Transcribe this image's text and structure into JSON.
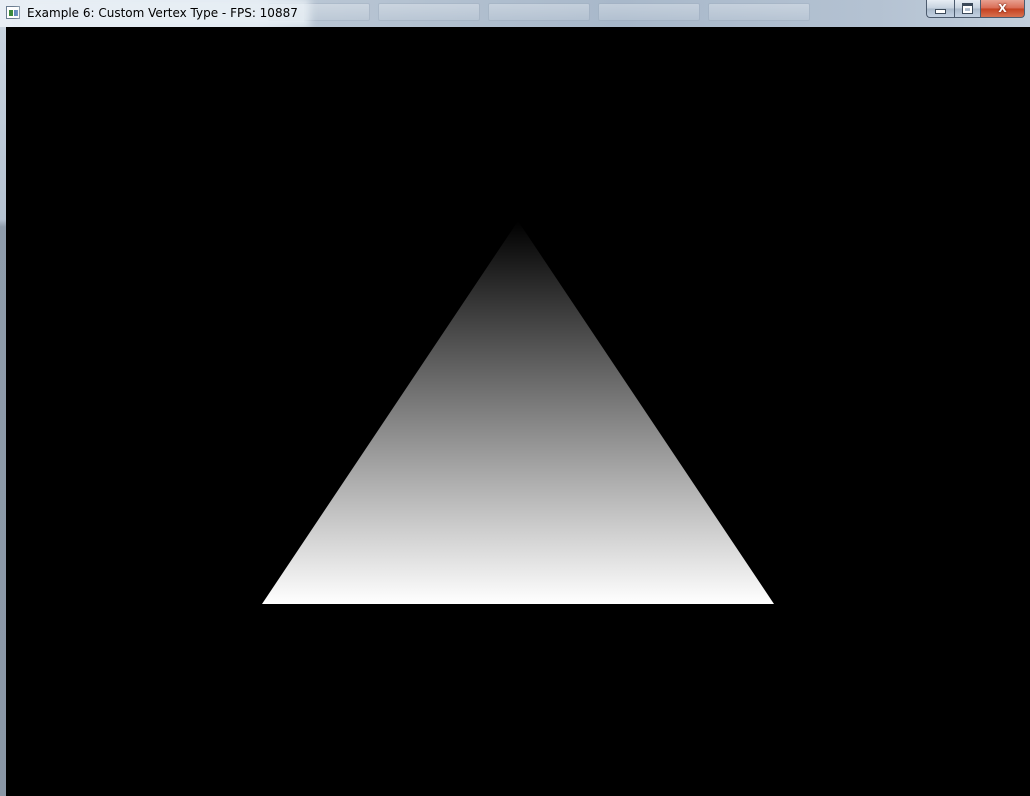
{
  "window": {
    "title": "Example 6: Custom Vertex Type - FPS: 10887",
    "controls": {
      "minimize": "minimize-icon",
      "maximize": "maximize-icon",
      "close": "close-icon",
      "close_glyph": "X"
    }
  },
  "scene": {
    "background_color": "#000000",
    "triangle": {
      "top_color": "#000000",
      "bottom_color": "#ffffff"
    }
  }
}
